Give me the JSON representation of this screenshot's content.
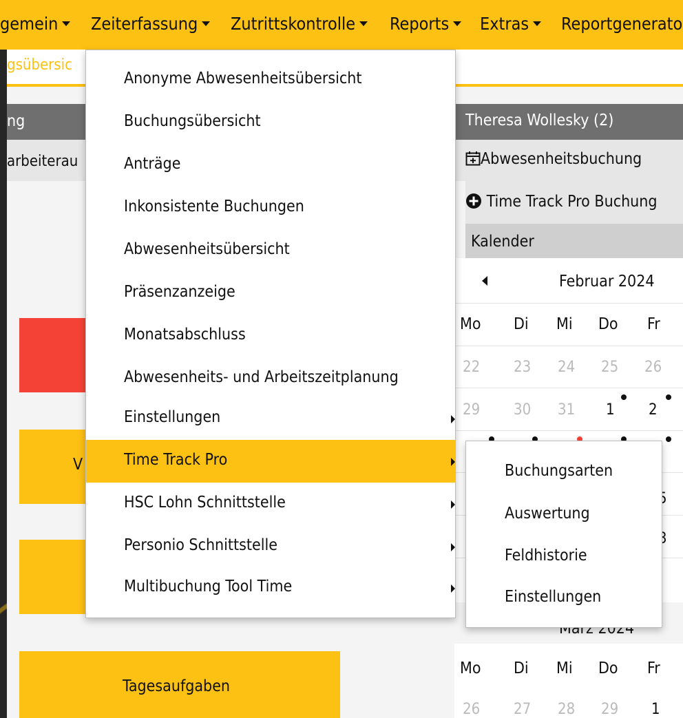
{
  "nav": {
    "items": [
      "gemein",
      "Zeiterfassung",
      "Zutrittskontrolle",
      "Reports",
      "Extras",
      "Reportgenerato"
    ]
  },
  "subbar": {
    "tab_label": "gsübersic"
  },
  "left": {
    "header_partial": "ng",
    "row_partial": "arbeiterau",
    "box_partial_v": "V",
    "tasks_button": "Tagesaufgaben"
  },
  "right": {
    "user_header": "Theresa Wollesky (2)",
    "absence_booking": "Abwesenheitsbuchung",
    "ttp_booking": "Time Track Pro Buchung",
    "calendar_title": "Kalender",
    "month1": "Februar 2024",
    "weekdays": [
      "Mo",
      "Di",
      "Mi",
      "Do",
      "Fr"
    ],
    "week1": [
      "22",
      "23",
      "24",
      "25",
      "26"
    ],
    "week2": [
      "29",
      "30",
      "31",
      "1",
      "2"
    ],
    "partial_digits": [
      "5",
      "3"
    ],
    "month2_partial": "März 2024",
    "week_m2": [
      "26",
      "27",
      "28",
      "29",
      "1"
    ]
  },
  "menu": {
    "items": [
      {
        "label": "Anonyme Abwesenheitsübersicht",
        "submenu": false
      },
      {
        "label": "Buchungsübersicht",
        "submenu": false
      },
      {
        "label": "Anträge",
        "submenu": false
      },
      {
        "label": "Inkonsistente Buchungen",
        "submenu": false
      },
      {
        "label": "Abwesenheitsübersicht",
        "submenu": false
      },
      {
        "label": "Präsenzanzeige",
        "submenu": false
      },
      {
        "label": "Monatsabschluss",
        "submenu": false
      },
      {
        "label": "Abwesenheits- und Arbeitszeitplanung",
        "submenu": false
      },
      {
        "label": "Einstellungen",
        "submenu": true
      },
      {
        "label": "Time Track Pro",
        "submenu": true,
        "active": true
      },
      {
        "label": "HSC Lohn Schnittstelle",
        "submenu": true
      },
      {
        "label": "Personio Schnittstelle",
        "submenu": true
      },
      {
        "label": "Multibuchung Tool Time",
        "submenu": true
      }
    ]
  },
  "submenu": {
    "items": [
      "Buchungsarten",
      "Auswertung",
      "Feldhistorie",
      "Einstellungen"
    ]
  },
  "colors": {
    "accent": "#fdc113",
    "danger": "#f44336",
    "header_grey": "#6f6f6f"
  }
}
